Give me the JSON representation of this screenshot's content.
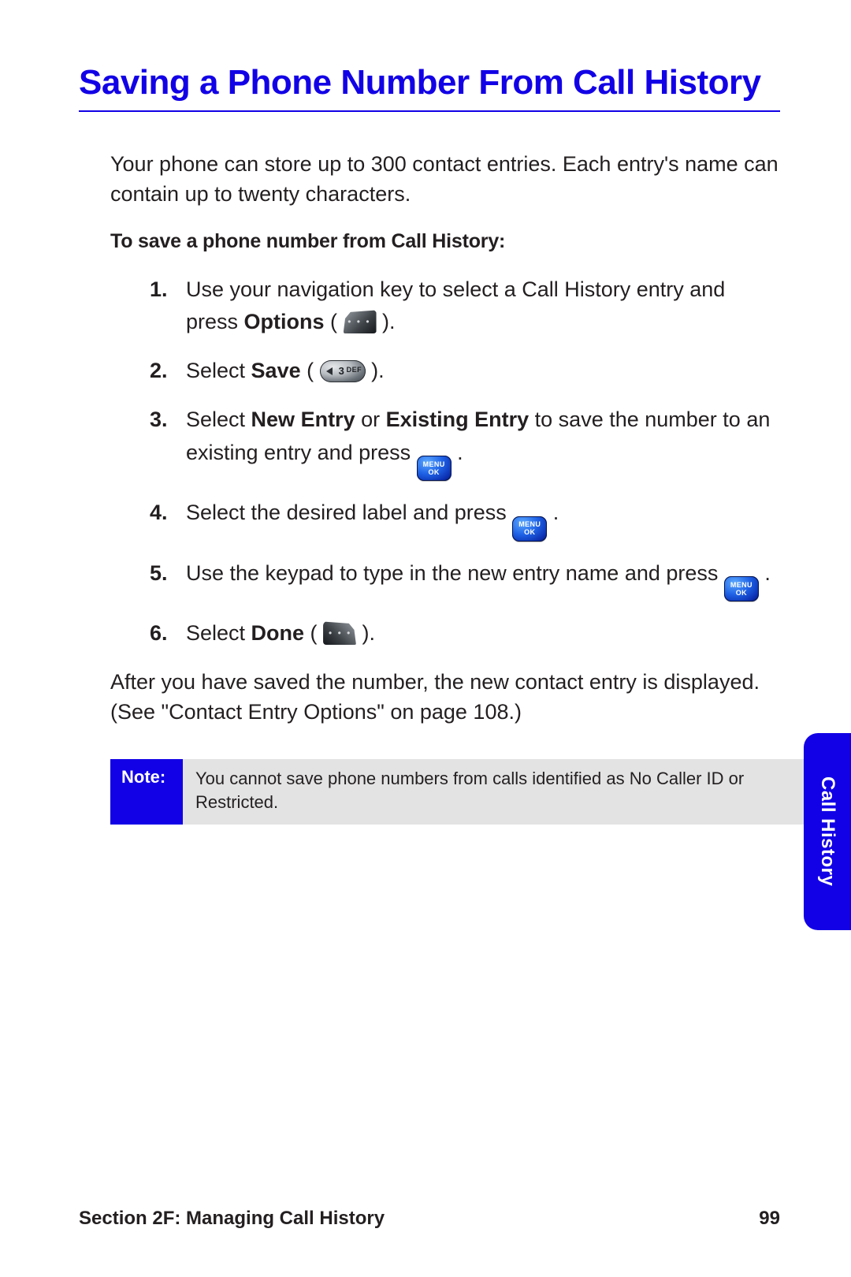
{
  "title": "Saving a Phone Number From Call History",
  "intro": "Your phone can store up to 300 contact entries. Each entry's name can contain up to twenty characters.",
  "subhead": "To save a phone number from Call History:",
  "steps": {
    "s1a": "Use your navigation key to select a Call History entry and press ",
    "s1b": "Options",
    "s1c": " ( ",
    "s1d": " ).",
    "s2a": "Select ",
    "s2b": "Save",
    "s2c": " ( ",
    "s2d": " ).",
    "s3a": "Select ",
    "s3b": "New Entry",
    "s3c": " or ",
    "s3d": "Existing Entry",
    "s3e": " to save the number to an existing entry and press ",
    "s3f": " .",
    "s4a": "Select the desired label and press ",
    "s4b": " .",
    "s5a": "Use the keypad to type in the new entry name and press ",
    "s5b": " .",
    "s6a": "Select ",
    "s6b": "Done",
    "s6c": " ( ",
    "s6d": " )."
  },
  "after": "After you have saved the number, the new contact entry is displayed. (See \"Contact Entry Options\" on page 108.)",
  "note": {
    "label": "Note:",
    "body": "You cannot save phone numbers from calls identified as No Caller ID or Restricted."
  },
  "tab": "Call History",
  "footer": {
    "section": "Section 2F: Managing Call History",
    "page": "99"
  },
  "keys": {
    "menu_l1": "MENU",
    "menu_l2": "OK",
    "num3_n": "3",
    "num3_t": "DEF",
    "softdots": "• • •"
  }
}
